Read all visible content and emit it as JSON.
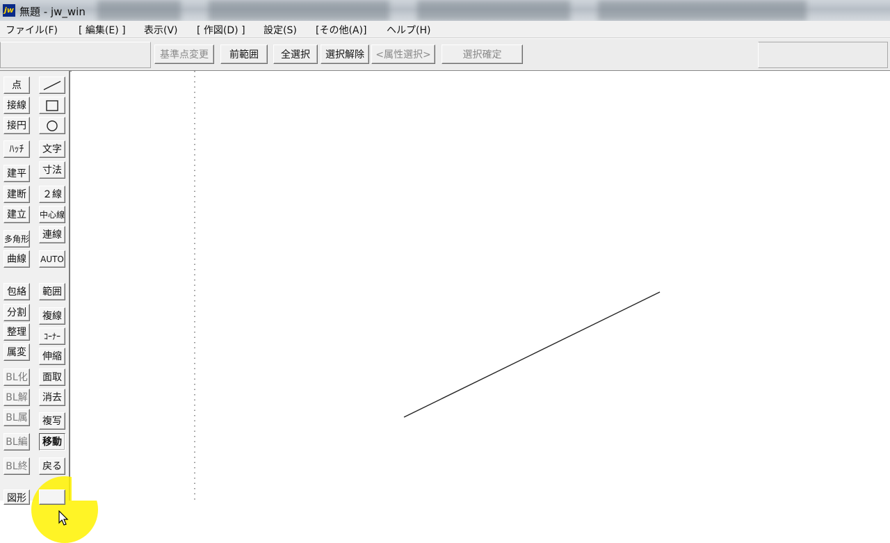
{
  "window": {
    "title": "無題 - jw_win",
    "icon": "jw-app-icon"
  },
  "menu": [
    "ファイル(F)",
    "[ 編集(E) ]",
    "表示(V)",
    "[ 作図(D) ]",
    "設定(S)",
    "[その他(A)]",
    "ヘルプ(H)"
  ],
  "toolbar": {
    "buttons": [
      "基準点変更",
      "前範囲",
      "全選択",
      "選択解除",
      "<属性選択>",
      "選択確定"
    ]
  },
  "palette": {
    "left": [
      "点",
      "接線",
      "接円",
      "ﾊｯﾁ",
      "建平",
      "建断",
      "建立",
      "多角形",
      "曲線",
      "包絡",
      "分割",
      "整理",
      "属変",
      "BL化",
      "BL解",
      "BL属",
      "BL編",
      "BL終",
      "図形"
    ],
    "right_icons": [
      "line-icon",
      "rectangle-icon",
      "circle-icon"
    ],
    "right": [
      "文字",
      "寸法",
      "２線",
      "中心線",
      "連線",
      "AUTO",
      "範囲",
      "複線",
      "ｺｰﾅｰ",
      "伸縮",
      "面取",
      "消去",
      "複写",
      "移動",
      "戻る"
    ]
  },
  "colors": {
    "highlight": "#fff200",
    "drawn_line": "#222222",
    "guide_line": "#555555"
  }
}
